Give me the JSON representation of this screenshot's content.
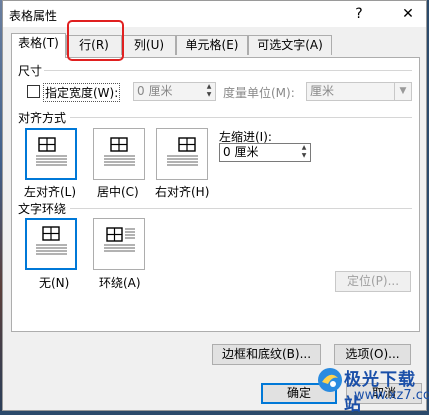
{
  "window": {
    "title": "表格属性",
    "help_label": "?",
    "close_label": "✕"
  },
  "tabs": [
    {
      "label": "表格(T)",
      "active": true
    },
    {
      "label": "行(R)"
    },
    {
      "label": "列(U)"
    },
    {
      "label": "单元格(E)"
    },
    {
      "label": "可选文字(A)"
    }
  ],
  "size": {
    "section_label": "尺寸",
    "checkbox_label": "指定宽度(W):",
    "width_value": "0 厘米",
    "unit_label": "度量单位(M):",
    "unit_value": "厘米"
  },
  "alignment": {
    "section_label": "对齐方式",
    "options": [
      {
        "label": "左对齐(L)",
        "selected": true
      },
      {
        "label": "居中(C)"
      },
      {
        "label": "右对齐(H)"
      }
    ],
    "indent_label": "左缩进(I):",
    "indent_value": "0 厘米"
  },
  "wrap": {
    "section_label": "文字环绕",
    "options": [
      {
        "label": "无(N)",
        "selected": true
      },
      {
        "label": "环绕(A)"
      }
    ],
    "position_button": "定位(P)..."
  },
  "footer": {
    "borders_button": "边框和底纹(B)...",
    "options_button": "选项(O)...",
    "ok_button": "确定",
    "cancel_button": "取消"
  },
  "watermark": {
    "text": "极光下载站",
    "url": "www.xz7.com"
  },
  "colors": {
    "accent": "#0078d7",
    "highlight": "#e02020",
    "watermark": "#1a4fa8"
  }
}
